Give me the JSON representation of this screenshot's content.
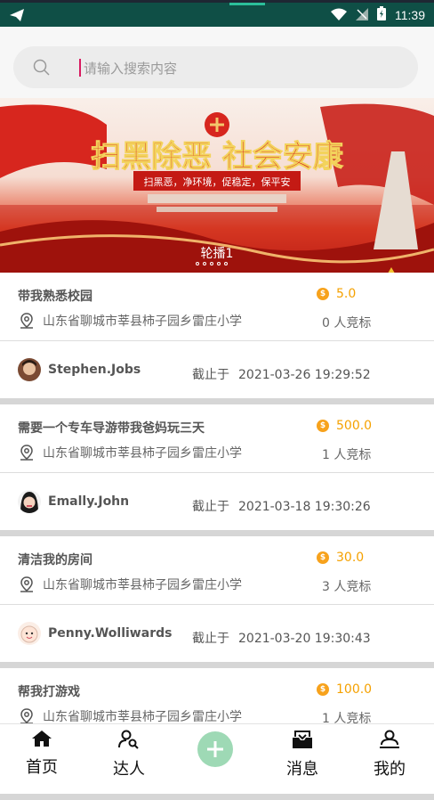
{
  "statusbar": {
    "time": "11:39"
  },
  "search": {
    "placeholder": "请输入搜索内容"
  },
  "banner": {
    "caption": "轮播1",
    "headline": "扫黑除恶 社会安康",
    "slogan": "扫黑恶，净环境，促稳定，保平安"
  },
  "tasks": [
    {
      "title": "带我熟悉校园",
      "price": "5.0",
      "location": "山东省聊城市莘县柿子园乡雷庄小学",
      "bidders": "0 人竞标",
      "user": "Stephen.Jobs",
      "deadline_label": "截止于",
      "deadline": "2021-03-26 19:29:52"
    },
    {
      "title": "需要一个专车导游带我爸妈玩三天",
      "price": "500.0",
      "location": "山东省聊城市莘县柿子园乡雷庄小学",
      "bidders": "1 人竞标",
      "user": "Emally.John",
      "deadline_label": "截止于",
      "deadline": "2021-03-18 19:30:26"
    },
    {
      "title": "清洁我的房间",
      "price": "30.0",
      "location": "山东省聊城市莘县柿子园乡雷庄小学",
      "bidders": "3 人竞标",
      "user": "Penny.Wolliwards",
      "deadline_label": "截止于",
      "deadline": "2021-03-20 19:30:43"
    },
    {
      "title": "帮我打游戏",
      "price": "100.0",
      "location": "山东省聊城市莘县柿子园乡雷庄小学",
      "bidders": "1 人竞标"
    }
  ],
  "tabs": {
    "home": "首页",
    "experts": "达人",
    "messages": "消息",
    "mine": "我的"
  },
  "colors": {
    "accent": "#f5a100",
    "status_bar": "#0f4f46",
    "add_button": "#9ed9b5"
  },
  "icons": {
    "location": "location-pin-icon",
    "coin": "coin-icon",
    "search": "search-icon"
  }
}
